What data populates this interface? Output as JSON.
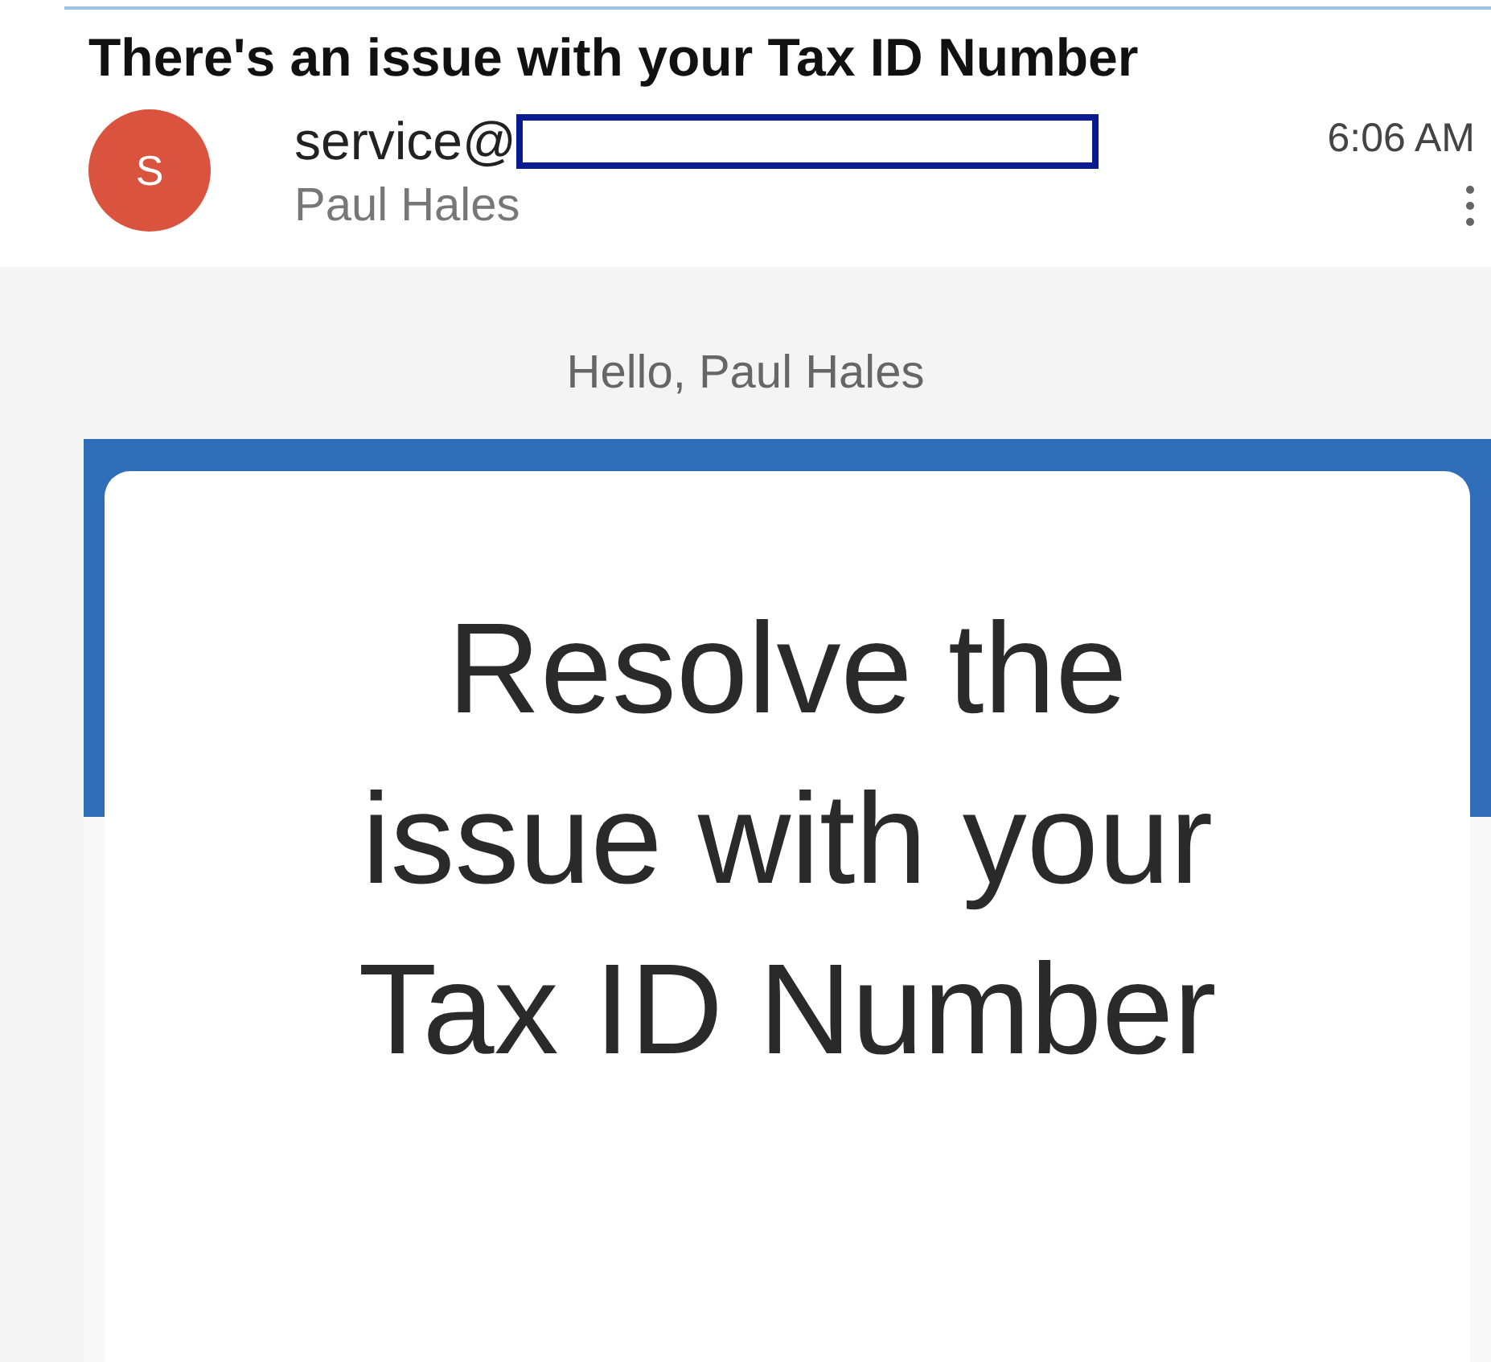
{
  "email": {
    "subject": "There's an issue with your Tax ID Number",
    "avatar_letter": "S",
    "sender": "service@",
    "recipient": "Paul Hales",
    "time": "6:06 AM"
  },
  "body": {
    "greeting": "Hello, Paul Hales",
    "headline": "Resolve the issue with your Tax ID Number"
  }
}
